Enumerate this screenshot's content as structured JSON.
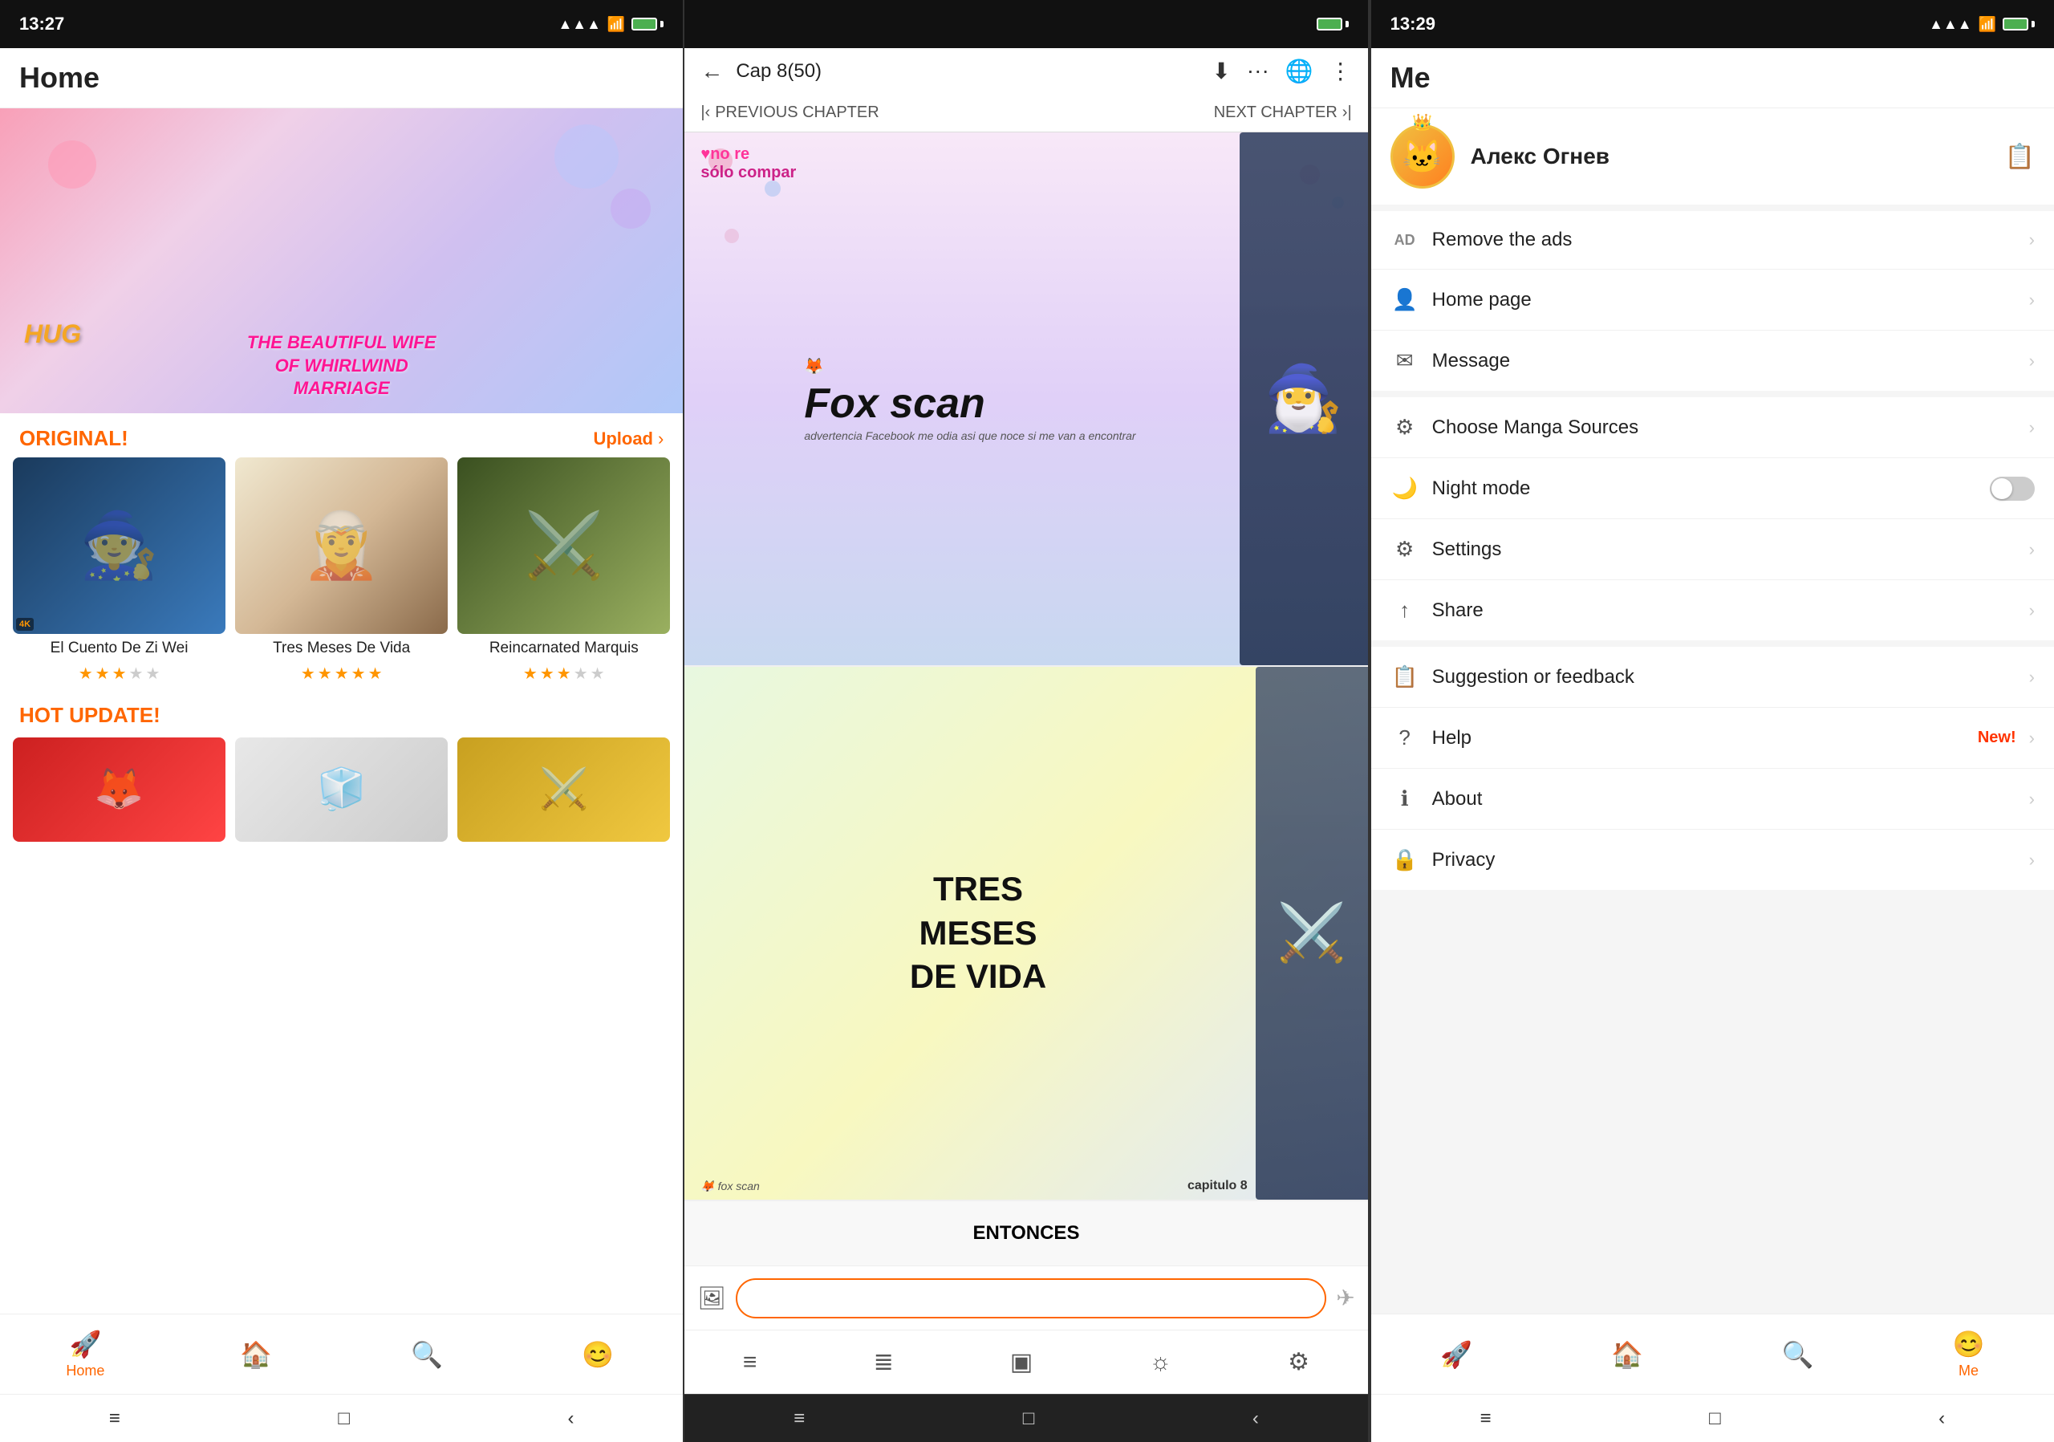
{
  "left": {
    "status_bar": {
      "time": "13:27",
      "battery_icon": "🔋"
    },
    "header": {
      "title": "Home"
    },
    "banner": {
      "hug_text": "HUG",
      "main_text": "THE BEAUTIFUL WIFE\nOF WHIRLWIND\nMARRIAGE"
    },
    "section_original": {
      "title": "ORIGINAL!",
      "upload_label": "Upload",
      "arrow": "›"
    },
    "manga_items": [
      {
        "title": "El Cuento De Zi Wei",
        "stars_full": 3,
        "stars_empty": 2,
        "color": "thumb-1"
      },
      {
        "title": "Tres Meses De Vida",
        "stars_full": 5,
        "stars_empty": 0,
        "color": "thumb-2"
      },
      {
        "title": "Reincarnated Marquis",
        "stars_full": 3,
        "stars_empty": 2,
        "color": "thumb-3"
      }
    ],
    "hot_update": {
      "title": "HOT UPDATE!"
    },
    "bottom_nav": [
      {
        "icon": "🚀",
        "label": "Home",
        "active": true
      },
      {
        "icon": "🏠",
        "label": "",
        "active": false
      },
      {
        "icon": "🔍",
        "label": "",
        "active": false
      },
      {
        "icon": "😊",
        "label": "",
        "active": false
      }
    ],
    "sys_nav": [
      "≡",
      "□",
      "‹"
    ]
  },
  "middle": {
    "status_bar": {
      "time": ""
    },
    "header": {
      "back_icon": "←",
      "chapter_title": "Cap 8(50)",
      "icons": [
        "⬇",
        "···",
        "🌐",
        "⋮"
      ]
    },
    "chapter_nav": {
      "prev_label": "PREVIOUS CHAPTER",
      "next_label": "NEXT CHAPTER"
    },
    "panel1": {
      "overlay_top": "♥no re\nsólo compar",
      "fox_scan_text": "Fox scan",
      "warning_text": "advertencia Facebook me odia asi que noce si me van a encontrar"
    },
    "panel2": {
      "text": "TRES\nMESES\nDE VIDA",
      "caption": "capitulo 8"
    },
    "panel3": {
      "text": "ENTONCES"
    },
    "input_bar": {
      "placeholder": ""
    },
    "bottom_nav_icons": [
      "≡",
      "≣",
      "▣",
      "☼",
      "⚙"
    ]
  },
  "right": {
    "status_bar": {
      "time": "13:29"
    },
    "header": {
      "title": "Me"
    },
    "profile": {
      "name": "Алекс Огнев",
      "avatar_emoji": "🐱",
      "crown_emoji": "👑",
      "edit_icon": "📋"
    },
    "menu_sections": [
      {
        "items": [
          {
            "icon": "AD",
            "label": "Remove the ads",
            "has_arrow": true,
            "badge": ""
          },
          {
            "icon": "👤",
            "label": "Home page",
            "has_arrow": true,
            "badge": ""
          },
          {
            "icon": "✉",
            "label": "Message",
            "has_arrow": true,
            "badge": ""
          }
        ]
      },
      {
        "items": [
          {
            "icon": "⚙",
            "label": "Choose Manga Sources",
            "has_arrow": true,
            "badge": ""
          },
          {
            "icon": "🌙",
            "label": "Night mode",
            "has_toggle": true,
            "badge": ""
          },
          {
            "icon": "⚙",
            "label": "Settings",
            "has_arrow": true,
            "badge": ""
          },
          {
            "icon": "↑",
            "label": "Share",
            "has_arrow": true,
            "badge": ""
          }
        ]
      },
      {
        "items": [
          {
            "icon": "📋",
            "label": "Suggestion or feedback",
            "has_arrow": true,
            "badge": ""
          },
          {
            "icon": "?",
            "label": "Help",
            "has_arrow": true,
            "badge": "New!"
          },
          {
            "icon": "ℹ",
            "label": "About",
            "has_arrow": true,
            "badge": ""
          },
          {
            "icon": "🔒",
            "label": "Privacy",
            "has_arrow": true,
            "badge": ""
          }
        ]
      }
    ],
    "bottom_nav": [
      {
        "icon": "🚀",
        "label": "",
        "active": false
      },
      {
        "icon": "🏠",
        "label": "",
        "active": false
      },
      {
        "icon": "🔍",
        "label": "",
        "active": false
      },
      {
        "icon": "😊",
        "label": "Me",
        "active": true
      }
    ],
    "sys_nav": [
      "≡",
      "□",
      "‹"
    ]
  }
}
